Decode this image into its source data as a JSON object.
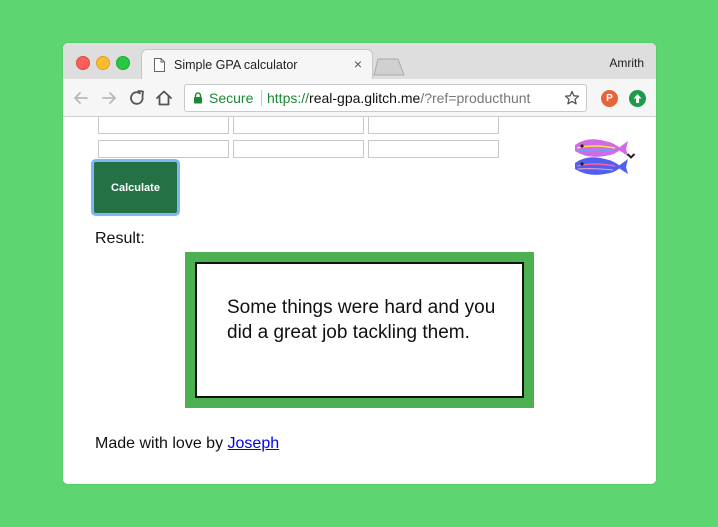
{
  "browser": {
    "tab_title": "Simple GPA calculator",
    "tab_close": "×",
    "profile_name": "Amrith",
    "security_label": "Secure",
    "url_scheme": "https://",
    "url_host": "real-gpa.glitch.me",
    "url_rest": "/?ref=producthunt",
    "extensions": [
      {
        "label": "P",
        "color": "#e6643a"
      },
      {
        "label": "",
        "color": "#1d9a4a"
      }
    ]
  },
  "form": {
    "rows": [
      [
        "",
        "",
        ""
      ],
      [
        "",
        "",
        ""
      ]
    ],
    "calculate_label": "Calculate"
  },
  "result": {
    "label": "Result:",
    "message": "Some things were hard and you did a great job tackling them."
  },
  "footer": {
    "prefix": "Made with love by ",
    "author": "Joseph"
  },
  "colors": {
    "background": "#5dd672",
    "button": "#247146",
    "result_border": "#4caf50",
    "link": "#0000ee"
  }
}
